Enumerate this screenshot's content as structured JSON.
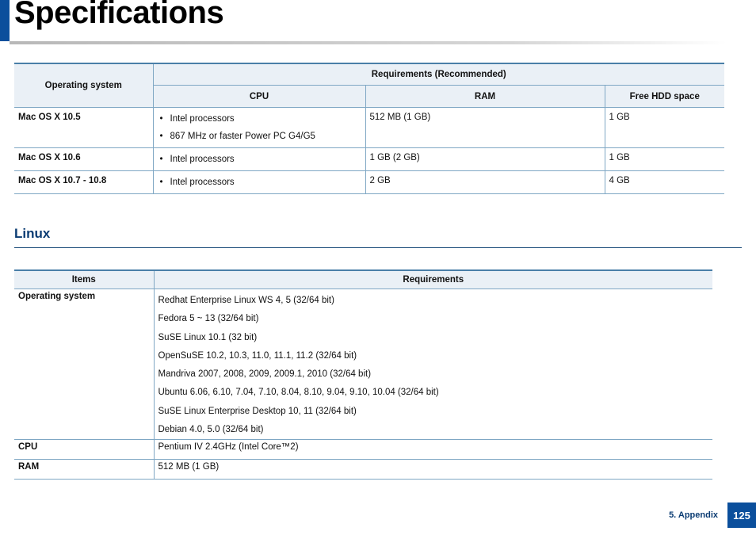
{
  "page": {
    "title": "Specifications",
    "footer_section": "5. Appendix",
    "page_number": "125"
  },
  "mac_table": {
    "headers": {
      "os": "Operating system",
      "requirements": "Requirements (Recommended)",
      "cpu": "CPU",
      "ram": "RAM",
      "hdd": "Free HDD space"
    },
    "rows": [
      {
        "os": "Mac OS X 10.5",
        "cpu": [
          "Intel   processors",
          "867 MHz or faster Power PC G4/G5"
        ],
        "ram": "512 MB (1 GB)",
        "hdd": "1 GB"
      },
      {
        "os": "Mac OS X 10.6",
        "cpu": [
          "Intel   processors"
        ],
        "ram": "1 GB (2 GB)",
        "hdd": "1 GB"
      },
      {
        "os": "Mac OS X 10.7 - 10.8",
        "cpu": [
          "Intel   processors"
        ],
        "ram": "2 GB",
        "hdd": "4 GB"
      }
    ]
  },
  "linux": {
    "heading": "Linux",
    "headers": {
      "items": "Items",
      "requirements": "Requirements"
    },
    "os_label": "Operating system",
    "os_list": [
      "Redhat   Enterprise Linux WS 4, 5 (32/64 bit)",
      "Fedora 5 ~ 13 (32/64 bit)",
      "SuSE Linux 10.1 (32 bit)",
      "OpenSuSE   10.2, 10.3, 11.0, 11.1, 11.2 (32/64 bit)",
      "Mandriva 2007, 2008, 2009, 2009.1, 2010 (32/64 bit)",
      "Ubuntu 6.06, 6.10, 7.04, 7.10, 8.04, 8.10, 9.04, 9.10, 10.04 (32/64 bit)",
      "SuSE Linux Enterprise Desktop 10, 11 (32/64 bit)",
      "Debian 4.0, 5.0 (32/64 bit)"
    ],
    "cpu_label": "CPU",
    "cpu_value": "Pentium IV 2.4GHz (Intel Core™2)",
    "ram_label": "RAM",
    "ram_value": "512 MB (1 GB)"
  },
  "colors": {
    "accent": "#0b4f9c",
    "heading": "#0b3c73",
    "table_border": "#7fa7c4",
    "header_bg": "#eaf0f6"
  }
}
